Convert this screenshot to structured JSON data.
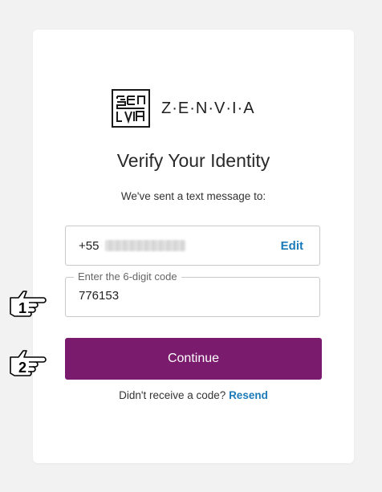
{
  "brand": {
    "logo_text": "Z·E·N·V·I·A"
  },
  "heading": {
    "title": "Verify Your Identity",
    "subtitle": "We've sent a text message to:"
  },
  "phone": {
    "prefix": "+55",
    "edit_label": "Edit"
  },
  "code_field": {
    "label": "Enter the 6-digit code",
    "value": "776153"
  },
  "actions": {
    "continue_label": "Continue",
    "resend_prompt": "Didn't receive a code?",
    "resend_label": "Resend"
  },
  "annotations": {
    "marker_1": "1",
    "marker_2": "2"
  },
  "colors": {
    "primary_button": "#7b1b6e",
    "link": "#1b7ab8",
    "page_background": "#f2f2f2"
  }
}
